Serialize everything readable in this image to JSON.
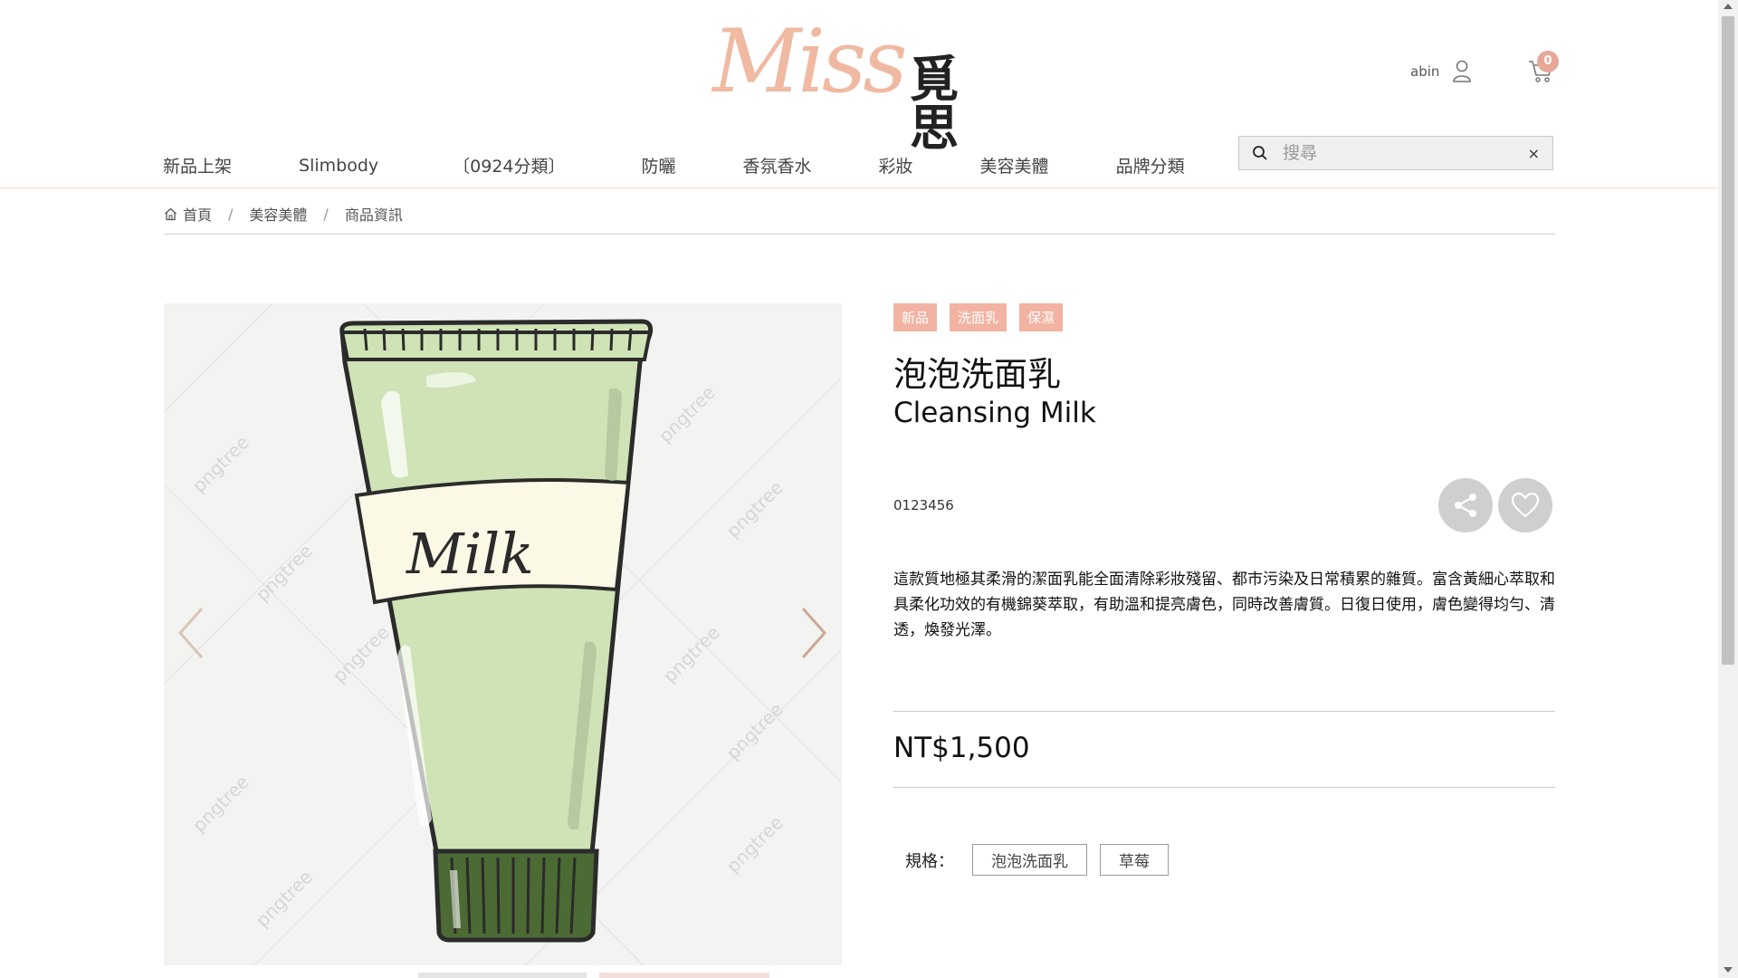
{
  "header": {
    "logo_script": "Miss",
    "logo_cn": "覓思",
    "user_name": "abin",
    "cart_count": "0"
  },
  "nav": {
    "items": [
      "新品上架",
      "Slimbody",
      "〔0924分類〕",
      "防曬",
      "香氛香水",
      "彩妝",
      "美容美體",
      "品牌分類"
    ]
  },
  "search": {
    "placeholder": "搜尋",
    "clear": "×"
  },
  "breadcrumb": {
    "home": "首頁",
    "category": "美容美體",
    "current": "商品資訊",
    "sep": "/"
  },
  "gallery": {
    "label_text": "Milk",
    "watermark": "pngtree"
  },
  "product": {
    "tags": [
      "新品",
      "洗面乳",
      "保濕"
    ],
    "title_cn": "泡泡洗面乳",
    "title_en": "Cleansing Milk",
    "sku": "0123456",
    "description": "這款質地極其柔滑的潔面乳能全面清除彩妝殘留、都市污染及日常積累的雜質。富含黃細心萃取和具柔化功效的有機錦葵萃取，有助溫和提亮膚色，同時改善膚質。日復日使用，膚色變得均勻、清透，煥發光澤。",
    "price": "NT$1,500",
    "spec_label": "規格：",
    "spec_options": [
      "泡泡洗面乳",
      "草莓"
    ]
  },
  "colors": {
    "accent": "#f2b3a3",
    "logo": "#f0b9a2",
    "badge": "#e7a89a"
  }
}
